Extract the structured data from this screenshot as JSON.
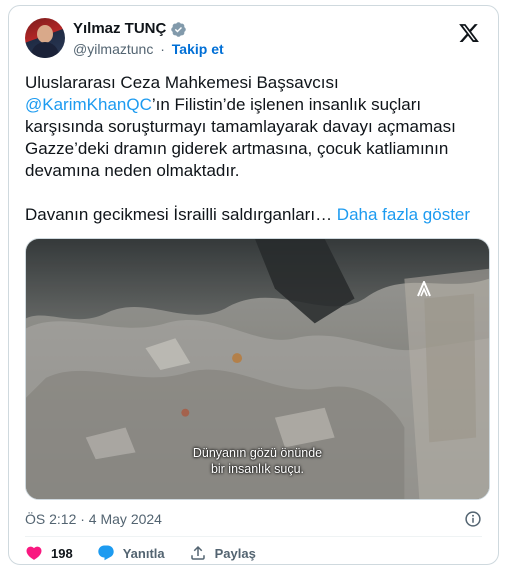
{
  "author": {
    "display_name": "Yılmaz TUNÇ",
    "handle": "@yilmaztunc",
    "separator": "·",
    "follow_label": "Takip et",
    "verified_color": "#829aab"
  },
  "tweet": {
    "text_before_mention": "Uluslararası Ceza Mahkemesi Başsavcısı ",
    "mention": "@KarimKhanQC",
    "text_after_mention": "’ın Filistin’de işlenen insanlık suçları karşısında soruşturmayı tamamlayarak davayı açmaması  Gazze’deki dramın giderek artmasına, çocuk katliamının devamına neden olmaktadır.\n\nDavanın gecikmesi İsrailli saldırganları… ",
    "show_more": "Daha fazla göster"
  },
  "media": {
    "caption_line1": "Dünyanın gözü önünde",
    "caption_line2": "bir insanlık suçu.",
    "watermark_icon": "anadolu-agency-logo"
  },
  "meta": {
    "timestamp": "ÖS 2:12 · 4 May 2024",
    "info_icon": "info-icon"
  },
  "actions": {
    "like_count": "198",
    "reply_label": "Yanıtla",
    "share_label": "Paylaş",
    "like_color": "#f91880",
    "reply_color": "#1d9bf0"
  },
  "colors": {
    "link": "#1d9bf0",
    "follow": "#006fd6",
    "secondary_text": "#536471",
    "border": "#cfd9de"
  }
}
